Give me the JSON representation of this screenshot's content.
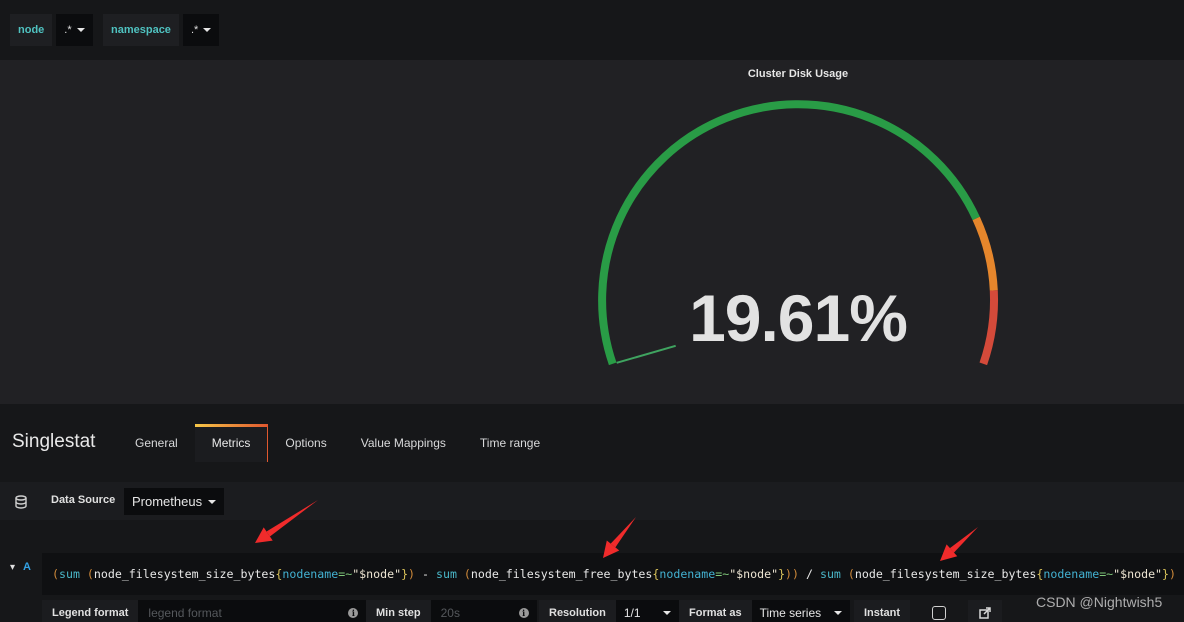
{
  "variables": [
    {
      "label": "node",
      "value": ".*"
    },
    {
      "label": "namespace",
      "value": ".*"
    }
  ],
  "panel": {
    "title": "Cluster Disk Usage",
    "value_text": "19.61%",
    "gauge": {
      "value": 19.61,
      "min": 0,
      "max": 100,
      "thresholds": [
        80,
        90
      ],
      "colors": {
        "ok": "#299c46",
        "warn": "#e5862c",
        "critical": "#d44a3a"
      }
    }
  },
  "editor": {
    "title": "Singlestat",
    "tabs": [
      {
        "label": "General",
        "active": false
      },
      {
        "label": "Metrics",
        "active": true
      },
      {
        "label": "Options",
        "active": false
      },
      {
        "label": "Value Mappings",
        "active": false
      },
      {
        "label": "Time range",
        "active": false
      }
    ],
    "data_source_label": "Data Source",
    "data_source_value": "Prometheus",
    "query": {
      "ref_id": "A",
      "expr": "(sum (node_filesystem_size_bytes{nodename=~\"$node\"}) - sum (node_filesystem_free_bytes{nodename=~\"$node\"})) / sum (node_filesystem_size_bytes{nodename=~\"$node\"})",
      "tokens": [
        {
          "t": "(",
          "c": "paren"
        },
        {
          "t": "sum",
          "c": "fn"
        },
        {
          "t": " ",
          "c": "metric"
        },
        {
          "t": "(",
          "c": "paren"
        },
        {
          "t": "node_filesystem_size_bytes",
          "c": "metric"
        },
        {
          "t": "{",
          "c": "brace"
        },
        {
          "t": "nodename",
          "c": "label"
        },
        {
          "t": "=~",
          "c": "op"
        },
        {
          "t": "\"$node\"",
          "c": "str"
        },
        {
          "t": "}",
          "c": "brace"
        },
        {
          "t": ")",
          "c": "paren"
        },
        {
          "t": " - ",
          "c": "metric"
        },
        {
          "t": "sum",
          "c": "fn"
        },
        {
          "t": " ",
          "c": "metric"
        },
        {
          "t": "(",
          "c": "paren"
        },
        {
          "t": "node_filesystem_free_bytes",
          "c": "metric"
        },
        {
          "t": "{",
          "c": "brace"
        },
        {
          "t": "nodename",
          "c": "label"
        },
        {
          "t": "=~",
          "c": "op"
        },
        {
          "t": "\"$node\"",
          "c": "str"
        },
        {
          "t": "}",
          "c": "brace"
        },
        {
          "t": "))",
          "c": "paren"
        },
        {
          "t": " / ",
          "c": "metric"
        },
        {
          "t": "sum",
          "c": "fn"
        },
        {
          "t": " ",
          "c": "metric"
        },
        {
          "t": "(",
          "c": "paren"
        },
        {
          "t": "node_filesystem_size_bytes",
          "c": "metric"
        },
        {
          "t": "{",
          "c": "brace"
        },
        {
          "t": "nodename",
          "c": "label"
        },
        {
          "t": "=~",
          "c": "op"
        },
        {
          "t": "\"$node\"",
          "c": "str"
        },
        {
          "t": "}",
          "c": "brace"
        },
        {
          "t": ")",
          "c": "paren"
        }
      ]
    },
    "options": {
      "legend_format_label": "Legend format",
      "legend_format_placeholder": "legend format",
      "min_step_label": "Min step",
      "min_step_placeholder": "20s",
      "resolution_label": "Resolution",
      "resolution_value": "1/1",
      "format_as_label": "Format as",
      "format_as_value": "Time series",
      "instant_label": "Instant",
      "instant_checked": false
    }
  },
  "watermark": "CSDN @Nightwish5",
  "annotation_color": "#f02b2b"
}
